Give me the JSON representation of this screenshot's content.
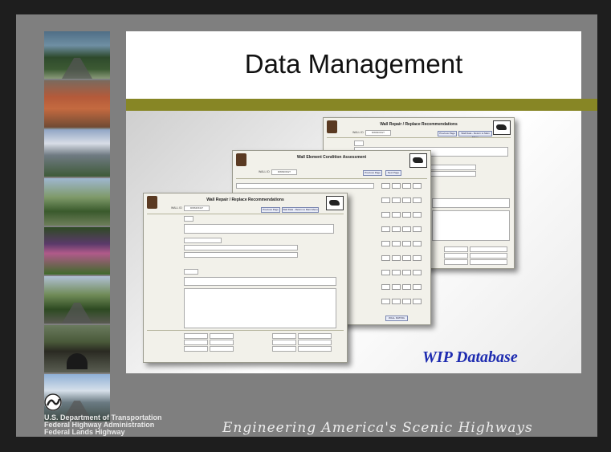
{
  "slide": {
    "title": "Data Management",
    "caption": "WIP Database",
    "agency_lines": [
      "U.S. Department of Transportation",
      "Federal Highway Administration",
      "Federal Lands Highway"
    ],
    "tagline": "Engineering America's Scenic Highways",
    "colors": {
      "background": "#7f7f7f",
      "accent_bar": "#878625",
      "caption": "#1d2bb0"
    }
  },
  "photos": [
    "mountain-forest-road-photo",
    "red-rock-canyon-photo",
    "snowy-peaks-photo",
    "bridge-valley-photo",
    "wildflowers-photo",
    "winding-road-photo",
    "tunnel-photo",
    "snow-mountain-road-photo"
  ],
  "windows": {
    "back": {
      "title": "Wall Repair / Replace Recommendations",
      "wall_id_label": "WALL ID",
      "wall_id_value": "DWMOKGT",
      "buttons": [
        "Previous Page",
        "Wall Data - Return to Main Menu"
      ]
    },
    "middle": {
      "title": "Wall Element Condition Assessment",
      "wall_id_label": "WALL ID",
      "wall_id_value": "DWMOKGT",
      "buttons": [
        "Previous Page",
        "Next Page"
      ],
      "footer_button": "WALL RATING"
    },
    "front": {
      "title": "Wall Repair / Replace Recommendations",
      "wall_id_label": "WALL ID",
      "wall_id_value": "DWMOKGT",
      "buttons": [
        "Previous Page",
        "Wall Data - Return to Main Menu"
      ]
    }
  },
  "icons": {
    "dot_logo": "dot-logo-icon",
    "usa_map": "usa-map-icon"
  }
}
